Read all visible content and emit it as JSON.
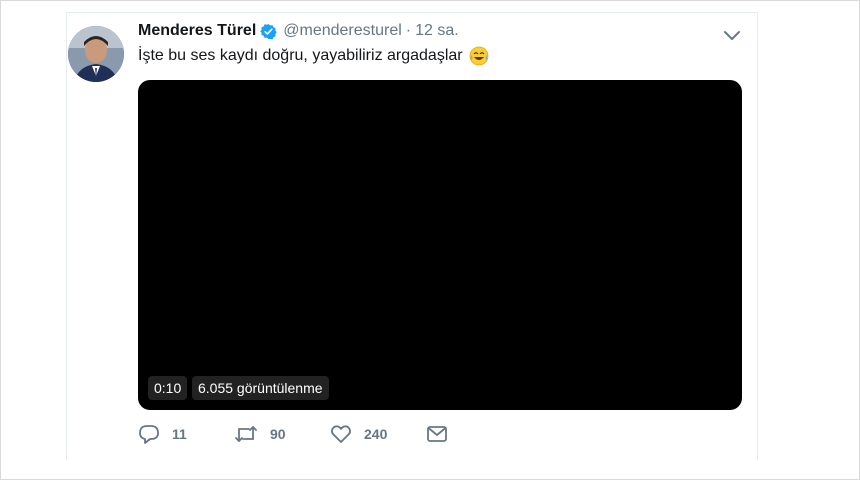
{
  "author": {
    "name": "Menderes Türel",
    "handle": "@menderesturel",
    "separator": "·",
    "time": "12 sa."
  },
  "tweet": {
    "text": "İşte bu ses kaydı doğru, yayabiliriz argadaşlar",
    "emoji": "face-with-tears-of-joy-icon"
  },
  "video": {
    "duration": "0:10",
    "views": "6.055 görüntülenme"
  },
  "actions": {
    "replies": "11",
    "retweets": "90",
    "likes": "240"
  },
  "colors": {
    "verified": "#1da1f2",
    "muted": "#657786",
    "text": "#14171a",
    "video_bg": "#000000"
  },
  "icons": [
    "verified-icon",
    "chevron-down-icon",
    "reply-icon",
    "retweet-icon",
    "like-icon",
    "direct-message-icon"
  ]
}
